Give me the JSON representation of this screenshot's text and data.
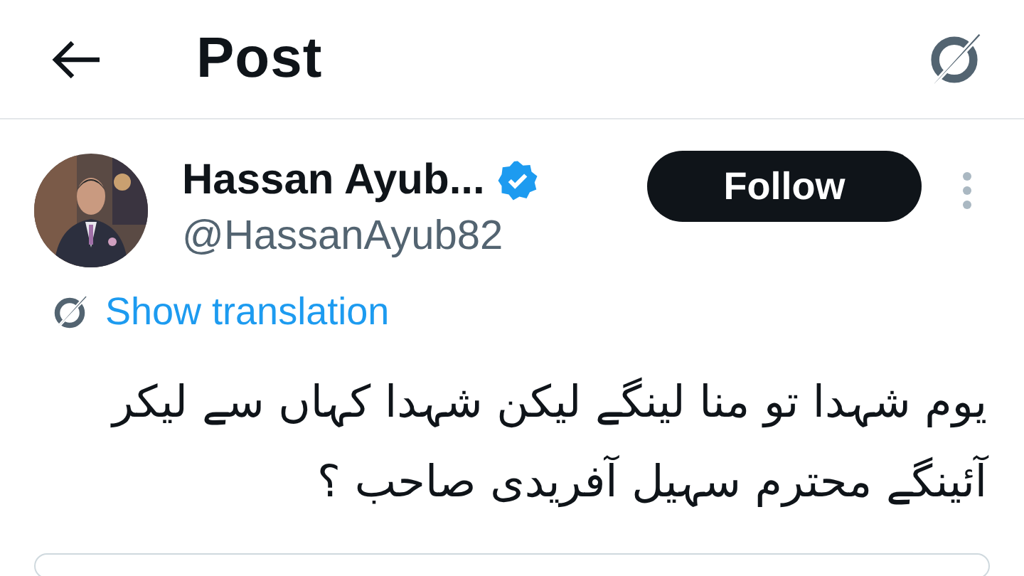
{
  "header": {
    "title": "Post"
  },
  "author": {
    "name": "Hassan Ayub...",
    "verified": true,
    "handle": "@HassanAyub82"
  },
  "follow_button": {
    "label": "Follow"
  },
  "translation": {
    "label": "Show translation"
  },
  "tweet": {
    "lines": [
      "یوم شہدا تو منا لینگے لیکن شہدا کہاں سے لیکر",
      "آئینگے محترم سہیل آفریدی صاحب ؟"
    ]
  }
}
